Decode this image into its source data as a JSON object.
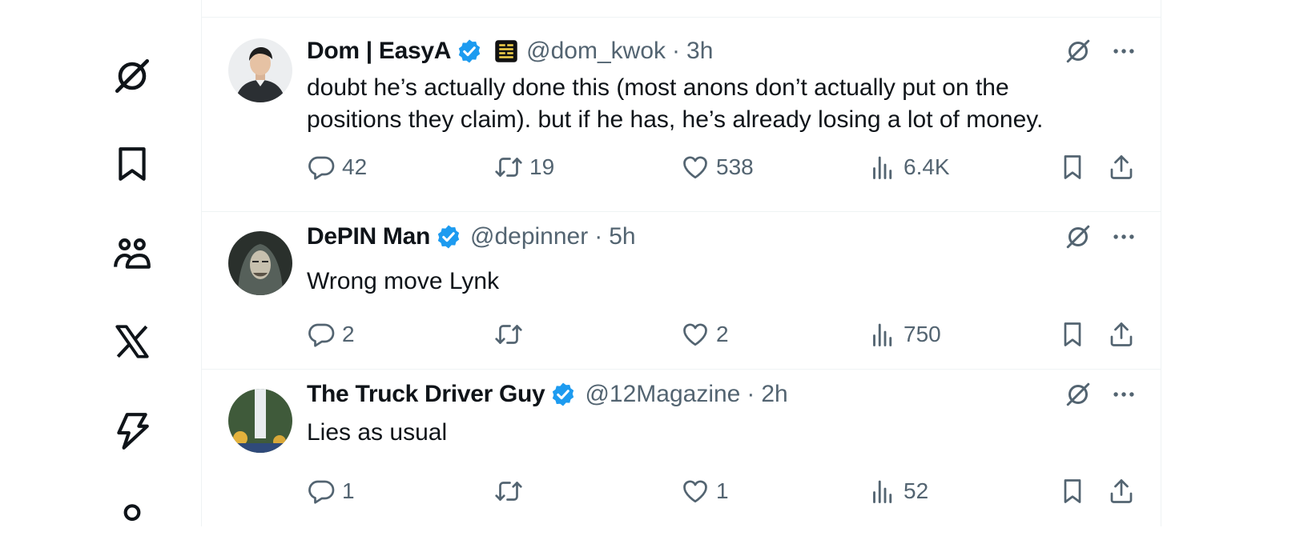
{
  "sidebar": {
    "items": [
      {
        "icon": "grok-icon"
      },
      {
        "icon": "bookmark-icon"
      },
      {
        "icon": "communities-icon"
      },
      {
        "icon": "x-premium-icon"
      },
      {
        "icon": "verified-orgs-icon"
      }
    ]
  },
  "posts": [
    {
      "name": "Dom | EasyA",
      "handle": "@dom_kwok",
      "dot": "·",
      "time": "3h",
      "text_lines": [
        "doubt he’s actually done this (most anons don’t actually put on the",
        "positions they claim). but if he has, he’s already losing a lot of money."
      ],
      "replies": "42",
      "reposts": "19",
      "likes": "538",
      "views": "6.4K"
    },
    {
      "name": "DePIN Man",
      "handle": "@depinner",
      "dot": "·",
      "time": "5h",
      "text_lines": [
        "Wrong move Lynk"
      ],
      "replies": "2",
      "reposts": "",
      "likes": "2",
      "views": "750"
    },
    {
      "name": "The Truck Driver Guy",
      "handle": "@12Magazine",
      "dot": "·",
      "time": "2h",
      "text_lines": [
        "Lies as usual"
      ],
      "replies": "1",
      "reposts": "",
      "likes": "1",
      "views": "52"
    }
  ],
  "colors": {
    "text_primary": "#0f1419",
    "text_secondary": "#536471",
    "verified_blue": "#1d9bf0",
    "divider": "#eff3f4"
  }
}
